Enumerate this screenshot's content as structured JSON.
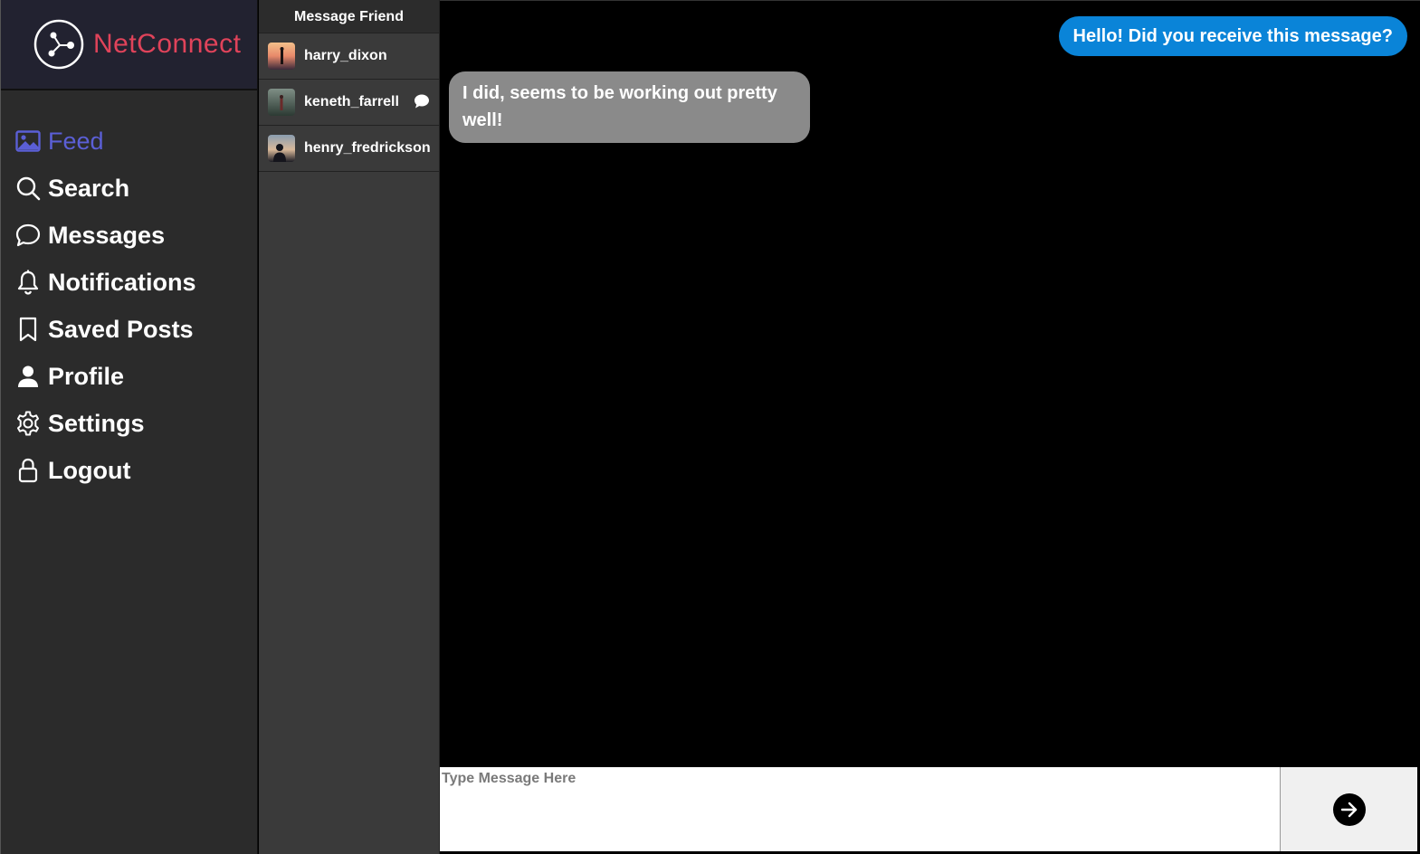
{
  "brand": {
    "name": "NetConnect",
    "logo_icon": "share-nodes-icon",
    "color": "#e0435a"
  },
  "nav": {
    "active_color": "#5b5fd6",
    "items": [
      {
        "label": "Feed",
        "icon": "image-icon",
        "active": true
      },
      {
        "label": "Search",
        "icon": "search-icon"
      },
      {
        "label": "Messages",
        "icon": "chat-bubble-icon"
      },
      {
        "label": "Notifications",
        "icon": "bell-icon"
      },
      {
        "label": "Saved Posts",
        "icon": "bookmark-icon"
      },
      {
        "label": "Profile",
        "icon": "person-icon"
      },
      {
        "label": "Settings",
        "icon": "gear-icon"
      },
      {
        "label": "Logout",
        "icon": "lock-icon"
      }
    ]
  },
  "friends": {
    "header": "Message Friend",
    "items": [
      {
        "username": "harry_dixon",
        "avatar": "avatar-sunset"
      },
      {
        "username": "keneth_farrell",
        "avatar": "avatar-forest",
        "has_message": true,
        "badge_icon": "message-icon"
      },
      {
        "username": "henry_fredrickson",
        "avatar": "avatar-dusk"
      }
    ]
  },
  "chat": {
    "messages": [
      {
        "direction": "outgoing",
        "text": "Hello! Did you receive this message?",
        "color": "#0a84d8"
      },
      {
        "direction": "incoming",
        "text": "I did, seems to be working out pretty well!",
        "color": "#8a8a8a"
      }
    ],
    "input_placeholder": "Type Message Here",
    "input_value": "",
    "send_icon": "arrow-right-icon"
  }
}
